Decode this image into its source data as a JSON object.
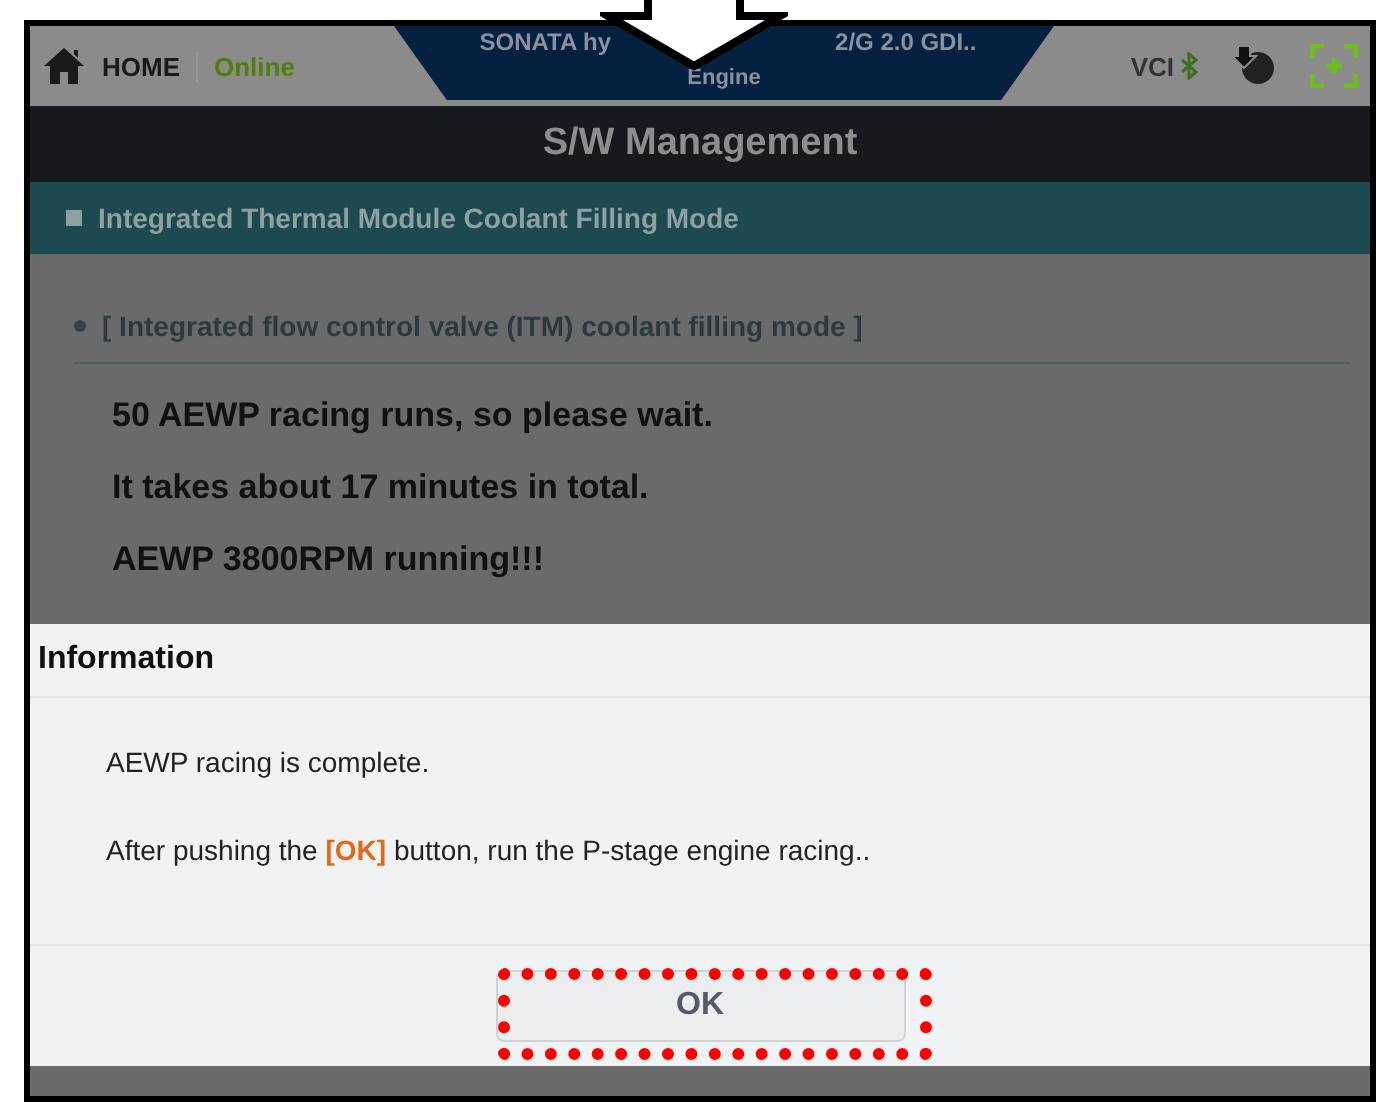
{
  "top_bar": {
    "home_label": "HOME",
    "status": "Online",
    "vehicle_title_parts": [
      "SONATA hy",
      "2/G 2.0 GDI.."
    ],
    "system": "Engine",
    "vci_label": "VCI"
  },
  "header": {
    "title": "S/W Management"
  },
  "section": {
    "title": "Integrated Thermal Module Coolant Filling Mode"
  },
  "content": {
    "heading": "[ Integrated flow control valve (ITM) coolant filling mode ]",
    "lines": [
      "50 AEWP racing runs, so please wait.",
      "It takes about 17 minutes in total.",
      "AEWP 3800RPM running!!!"
    ]
  },
  "dialog": {
    "title": "Information",
    "messages": [
      "AEWP racing is complete.",
      "After pushing the **[OK]** button, run the P-stage engine racing.."
    ],
    "button": "OK"
  }
}
